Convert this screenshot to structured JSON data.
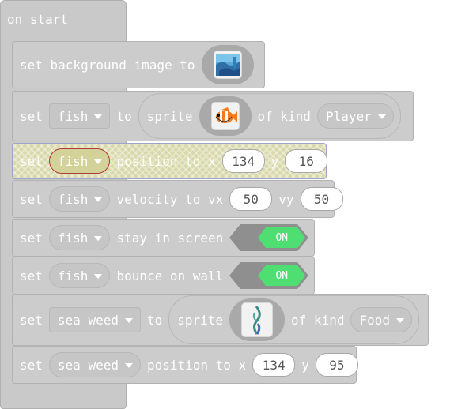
{
  "event": {
    "label": "on start"
  },
  "blocks": [
    {
      "set": "",
      "text": "set background image to"
    },
    {
      "set": "set",
      "var": "fish",
      "to": "to",
      "sprite": "sprite",
      "of_kind": "of kind",
      "kind": "Player"
    },
    {
      "set": "set",
      "var": "fish",
      "text": "position to x",
      "x": "134",
      "y_label": "y",
      "y": "16"
    },
    {
      "set": "set",
      "var": "fish",
      "text": "velocity to vx",
      "vx": "50",
      "vy_label": "vy",
      "vy": "50"
    },
    {
      "set": "set",
      "var": "fish",
      "text": "stay in screen",
      "toggle": "ON"
    },
    {
      "set": "set",
      "var": "fish",
      "text": "bounce on wall",
      "toggle": "ON"
    },
    {
      "set": "set",
      "var": "sea weed",
      "to": "to",
      "sprite": "sprite",
      "of_kind": "of kind",
      "kind": "Food"
    },
    {
      "set": "set",
      "var": "sea weed",
      "text": "position to x",
      "x": "134",
      "y_label": "y",
      "y": "95"
    }
  ],
  "colors": {
    "block": "#cccccc",
    "highlight": "#d8d8aa",
    "toggle_on": "#4ede72",
    "toggle_track": "#8f8f8f"
  },
  "icons": [
    "background-image-thumbnail",
    "fish-sprite-icon",
    "seaweed-sprite-icon"
  ]
}
